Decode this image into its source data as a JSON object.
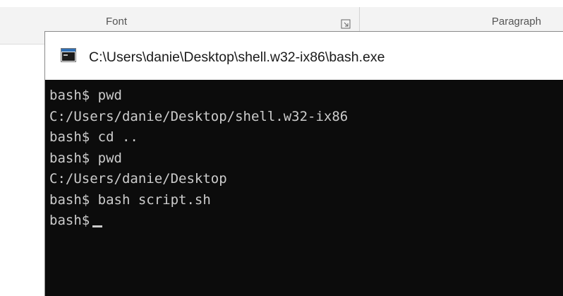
{
  "ribbon": {
    "groups": [
      "Font",
      "Paragraph"
    ]
  },
  "window": {
    "title": "C:\\Users\\danie\\Desktop\\shell.w32-ix86\\bash.exe"
  },
  "terminal": {
    "lines": [
      "bash$ pwd",
      "C:/Users/danie/Desktop/shell.w32-ix86",
      "bash$ cd ..",
      "bash$ pwd",
      "C:/Users/danie/Desktop",
      "bash$ bash script.sh"
    ],
    "prompt": "bash$"
  },
  "colors": {
    "terminal_bg": "#0c0c0c",
    "terminal_fg": "#cccccc",
    "titlebar_bg": "#ffffff"
  }
}
